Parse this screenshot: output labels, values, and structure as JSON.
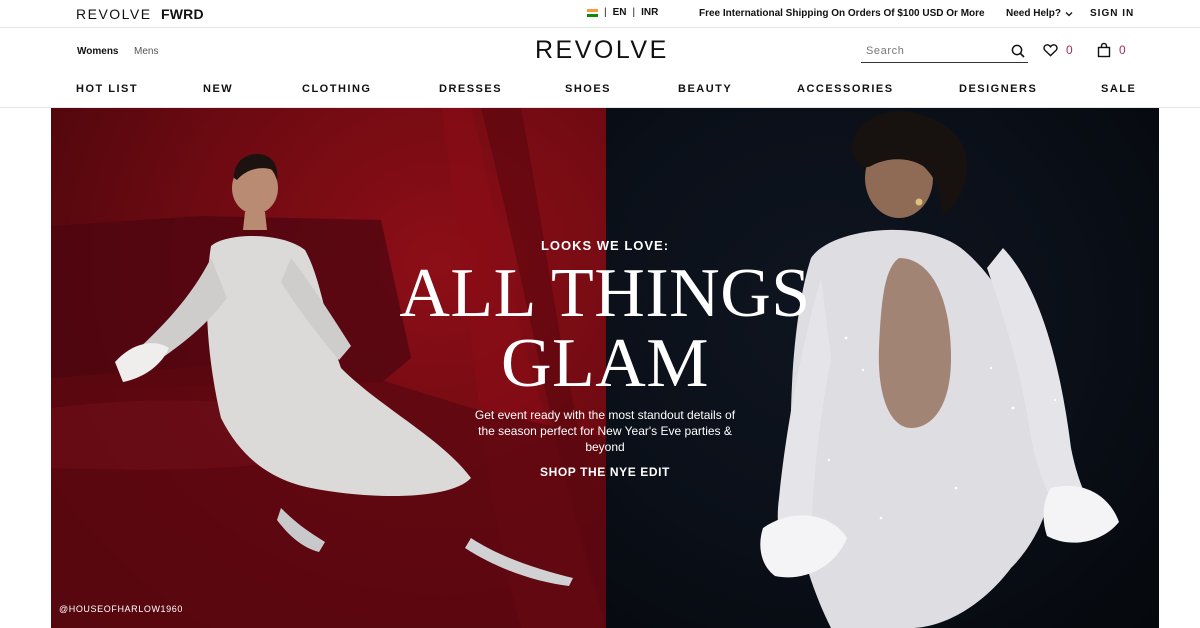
{
  "utility_bar": {
    "brand_revolve": "REVOLVE",
    "brand_fwrd": "FWRD",
    "locale": {
      "language": "EN",
      "currency": "INR",
      "separator": "|"
    },
    "shipping_message": "Free International Shipping On Orders Of $100 USD Or More",
    "help_label": "Need Help?",
    "signin_label": "SIGN IN"
  },
  "header": {
    "gender_tabs": [
      {
        "label": "Womens",
        "active": true
      },
      {
        "label": "Mens",
        "active": false
      }
    ],
    "logo": "REVOLVE",
    "search": {
      "placeholder": "Search",
      "value": ""
    },
    "wishlist_count": "0",
    "bag_count": "0"
  },
  "nav": {
    "items": [
      {
        "label": "HOT LIST"
      },
      {
        "label": "NEW"
      },
      {
        "label": "CLOTHING"
      },
      {
        "label": "DRESSES"
      },
      {
        "label": "SHOES"
      },
      {
        "label": "BEAUTY"
      },
      {
        "label": "ACCESSORIES"
      },
      {
        "label": "DESIGNERS"
      },
      {
        "label": "SALE"
      }
    ]
  },
  "hero": {
    "eyebrow": "LOOKS WE LOVE:",
    "headline_line1": "ALL THINGS",
    "headline_line2": "GLAM",
    "body": "Get event ready with the most standout details of the season perfect for New Year's Eve parties & beyond",
    "cta": "SHOP THE NYE EDIT",
    "credit": "@HOUSEOFHARLOW1960"
  },
  "colors": {
    "count_accent": "#a0304d",
    "hero_left": "#7a0c14",
    "hero_right": "#0a0f18"
  },
  "icons": {
    "flag": "india-flag-icon",
    "help": "chevron-down-icon",
    "search": "search-icon",
    "wishlist": "heart-icon",
    "bag": "shopping-bag-icon"
  }
}
